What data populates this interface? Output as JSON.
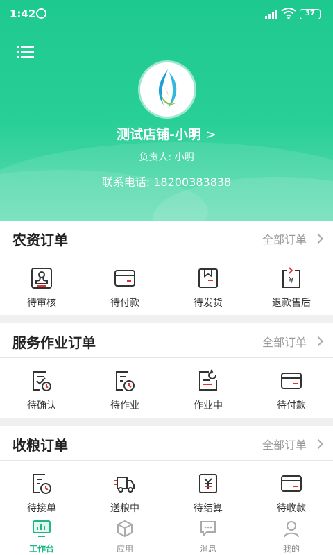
{
  "status_bar": {
    "time": "1:42",
    "battery": "37"
  },
  "header": {
    "store_name": "测试店铺-小明",
    "chevron": ">",
    "manager_label": "负责人:",
    "manager_name": "小明",
    "phone_label": "联系电话:",
    "phone": "18200383838"
  },
  "sections": [
    {
      "title": "农资订单",
      "more": "全部订单",
      "items": [
        {
          "label": "待审核",
          "icon": "stamp-icon"
        },
        {
          "label": "待付款",
          "icon": "card-icon"
        },
        {
          "label": "待发货",
          "icon": "package-icon"
        },
        {
          "label": "退款售后",
          "icon": "refund-icon"
        }
      ]
    },
    {
      "title": "服务作业订单",
      "more": "全部订单",
      "items": [
        {
          "label": "待确认",
          "icon": "confirm-icon"
        },
        {
          "label": "待作业",
          "icon": "clock-doc-icon"
        },
        {
          "label": "作业中",
          "icon": "in-progress-icon"
        },
        {
          "label": "待付款",
          "icon": "card-icon"
        }
      ]
    },
    {
      "title": "收粮订单",
      "more": "全部订单",
      "items": [
        {
          "label": "待接单",
          "icon": "clock-doc-icon"
        },
        {
          "label": "送粮中",
          "icon": "truck-icon"
        },
        {
          "label": "待结算",
          "icon": "settle-icon"
        },
        {
          "label": "待收款",
          "icon": "card-icon"
        }
      ]
    }
  ],
  "tabbar": {
    "tabs": [
      {
        "label": "工作台",
        "icon": "dashboard-icon",
        "active": true
      },
      {
        "label": "应用",
        "icon": "cube-icon",
        "active": false
      },
      {
        "label": "消息",
        "icon": "message-icon",
        "active": false
      },
      {
        "label": "我的",
        "icon": "user-icon",
        "active": false
      }
    ]
  },
  "colors": {
    "accent": "#1ec98f",
    "icon": "#333333",
    "muted": "#999999"
  }
}
